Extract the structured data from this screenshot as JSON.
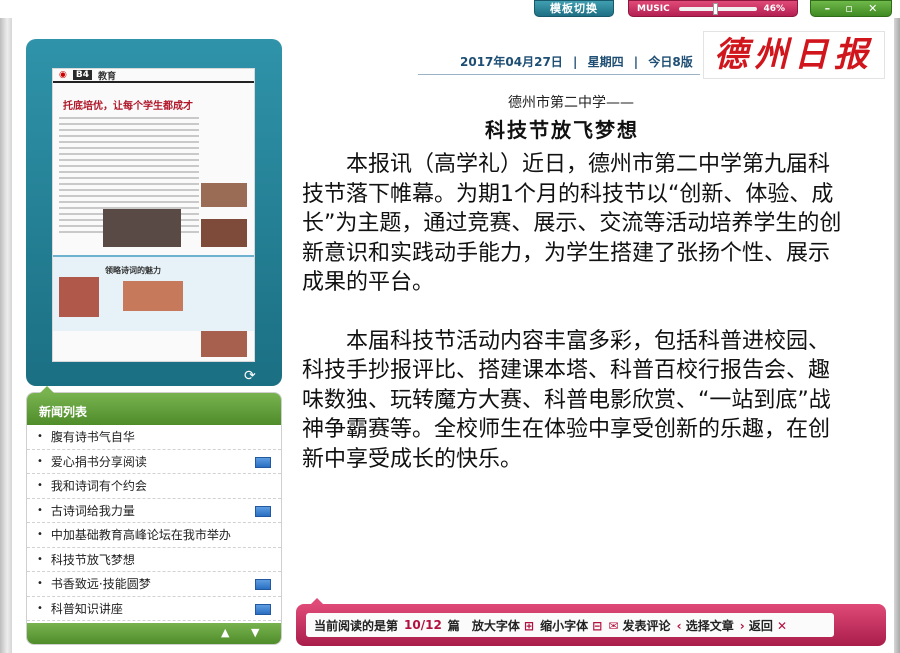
{
  "top_bar": {
    "template_switch_label": "模板切换",
    "music_label": "MUSIC",
    "music_volume": "46%",
    "music_volume_fraction": 0.46,
    "minimize_icon": "minimize-icon",
    "maximize_icon": "maximize-icon",
    "close_icon": "close-icon"
  },
  "masthead": {
    "date": "2017年04月27日",
    "weekday": "星期四",
    "pages": "今日8版",
    "paper_name": "德州日报"
  },
  "page_preview": {
    "page_label": "B4",
    "section": "教育",
    "headline": "托底培优，让每个学生都成才",
    "sub_headline": "领略诗词的魅力"
  },
  "news_list": {
    "title": "新闻列表",
    "items": [
      {
        "label": "腹有诗书气自华",
        "has_image": false
      },
      {
        "label": "爱心捐书分享阅读",
        "has_image": true
      },
      {
        "label": "我和诗词有个约会",
        "has_image": false
      },
      {
        "label": "古诗词给我力量",
        "has_image": true
      },
      {
        "label": "中加基础教育高峰论坛在我市举办",
        "has_image": false
      },
      {
        "label": "科技节放飞梦想",
        "has_image": false
      },
      {
        "label": "书香致远·技能圆梦",
        "has_image": true
      },
      {
        "label": "科普知识讲座",
        "has_image": true
      }
    ]
  },
  "article": {
    "subtitle": "德州市第二中学——",
    "title": "科技节放飞梦想",
    "paragraphs": [
      "本报讯（高学礼）近日，德州市第二中学第九届科技节落下帷幕。为期1个月的科技节以“创新、体验、成长”为主题，通过竞赛、展示、交流等活动培养学生的创新意识和实践动手能力，为学生搭建了张扬个性、展示成果的平台。",
      "本届科技节活动内容丰富多彩，包括科普进校园、科技手抄报评比、搭建课本塔、科普百校行报告会、趣味数独、玩转魔方大赛、科普电影欣赏、“一站到底”战神争霸赛等。全校师生在体验中享受创新的乐趣，在创新中享受成长的快乐。"
    ]
  },
  "toolbar": {
    "reading_prefix": "当前阅读的是第",
    "reading_position": "10/12",
    "reading_suffix": "篇",
    "enlarge_font": "放大字体",
    "shrink_font": "缩小字体",
    "comment": "发表评论",
    "select_article": "选择文章",
    "back": "返回"
  },
  "colors": {
    "accent_teal": "#1f6f84",
    "accent_green": "#4f8c2a",
    "accent_pink": "#b32052",
    "masthead_red": "#d0161c"
  }
}
